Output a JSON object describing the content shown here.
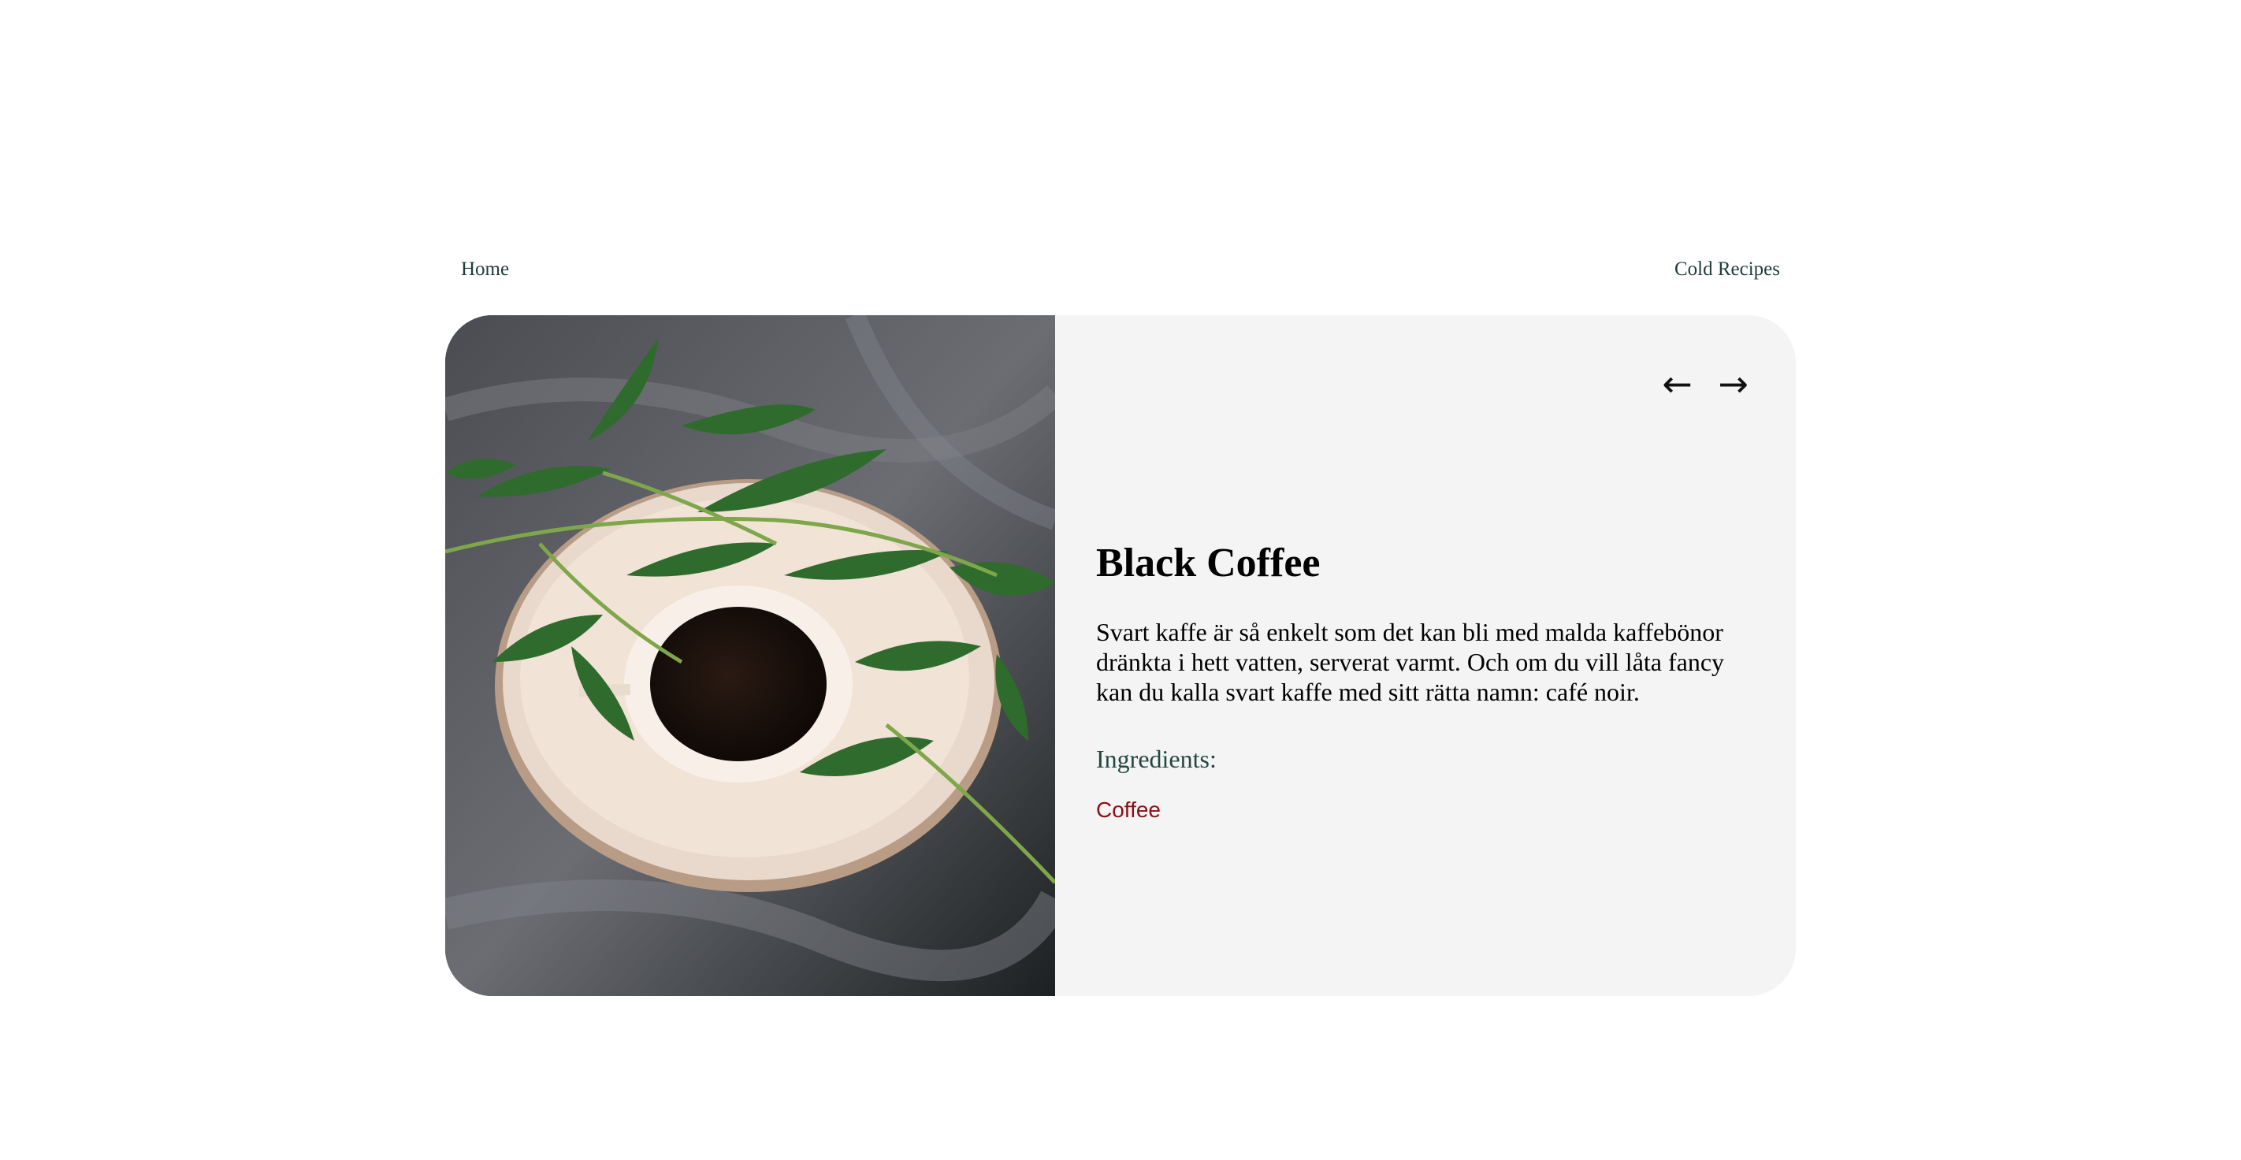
{
  "nav": {
    "home_label": "Home",
    "cold_recipes_label": "Cold Recipes"
  },
  "pager": {
    "prev_icon": "←",
    "next_icon": "→"
  },
  "recipe": {
    "title": "Black Coffee",
    "description": "Svart kaffe är så enkelt som det kan bli med malda kaffebönor dränkta i hett vatten, serverat varmt. Och om du vill låta fancy kan du kalla svart kaffe med sitt rätta namn: café noir.",
    "ingredients_heading": "Ingredients:",
    "ingredients": [
      "Coffee"
    ]
  },
  "colors": {
    "nav_link": "#1f3d3a",
    "heading_green": "#24473f",
    "ingredient_red": "#8b0f16",
    "card_bg": "#f4f4f4"
  },
  "icons": {
    "prev": "arrow-left-icon",
    "next": "arrow-right-icon"
  }
}
